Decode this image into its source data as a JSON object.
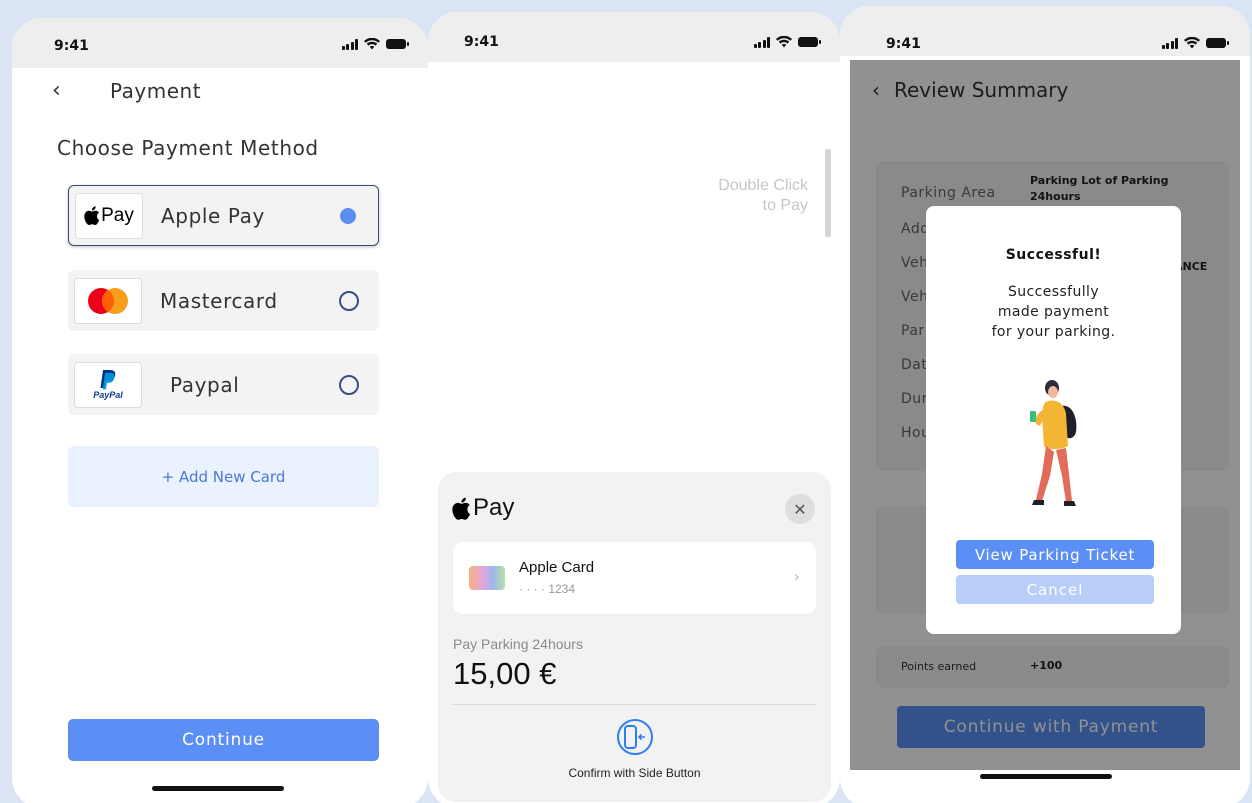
{
  "statusbar": {
    "time": "9:41"
  },
  "payment_screen": {
    "title": "Payment",
    "section_title": "Choose Payment Method",
    "methods": [
      {
        "label": "Apple Pay",
        "logo_text": "Pay",
        "selected": true
      },
      {
        "label": "Mastercard",
        "selected": false
      },
      {
        "label": "Paypal",
        "logo_text": "PayPal",
        "selected": false
      }
    ],
    "add_card": "+ Add New Card",
    "continue": "Continue"
  },
  "apple_pay_sheet": {
    "hint_line1": "Double Click",
    "hint_line2": "to Pay",
    "logo_text": "Pay",
    "close_glyph": "✕",
    "card_name": "Apple Card",
    "card_number": "· · · · 1234",
    "pay_label": "Pay Parking 24hours",
    "amount": "15,00 €",
    "confirm": "Confirm with Side Button"
  },
  "review_screen": {
    "title": "Review Summary",
    "rows": [
      {
        "label": "Parking Area",
        "value": "Parking Lot of Parking 24hours"
      },
      {
        "label": "Add",
        "value": ""
      },
      {
        "label": "Veh",
        "value": "ANCE"
      },
      {
        "label": "Veh",
        "value": ""
      },
      {
        "label": "Par",
        "value": ""
      },
      {
        "label": "Dat",
        "value": ""
      },
      {
        "label": "Dur",
        "value": ""
      },
      {
        "label": "Hou",
        "value": ""
      }
    ],
    "points_label": "Points earned",
    "points_value": "+100",
    "continue": "Continue with Payment",
    "modal": {
      "title": "Successful!",
      "message_line1": "Successfully",
      "message_line2": "made payment",
      "message_line3": "for your parking.",
      "primary": "View Parking Ticket",
      "secondary": "Cancel"
    }
  },
  "colors": {
    "accent": "#5b8ff5",
    "background": "#dbe4f5"
  }
}
